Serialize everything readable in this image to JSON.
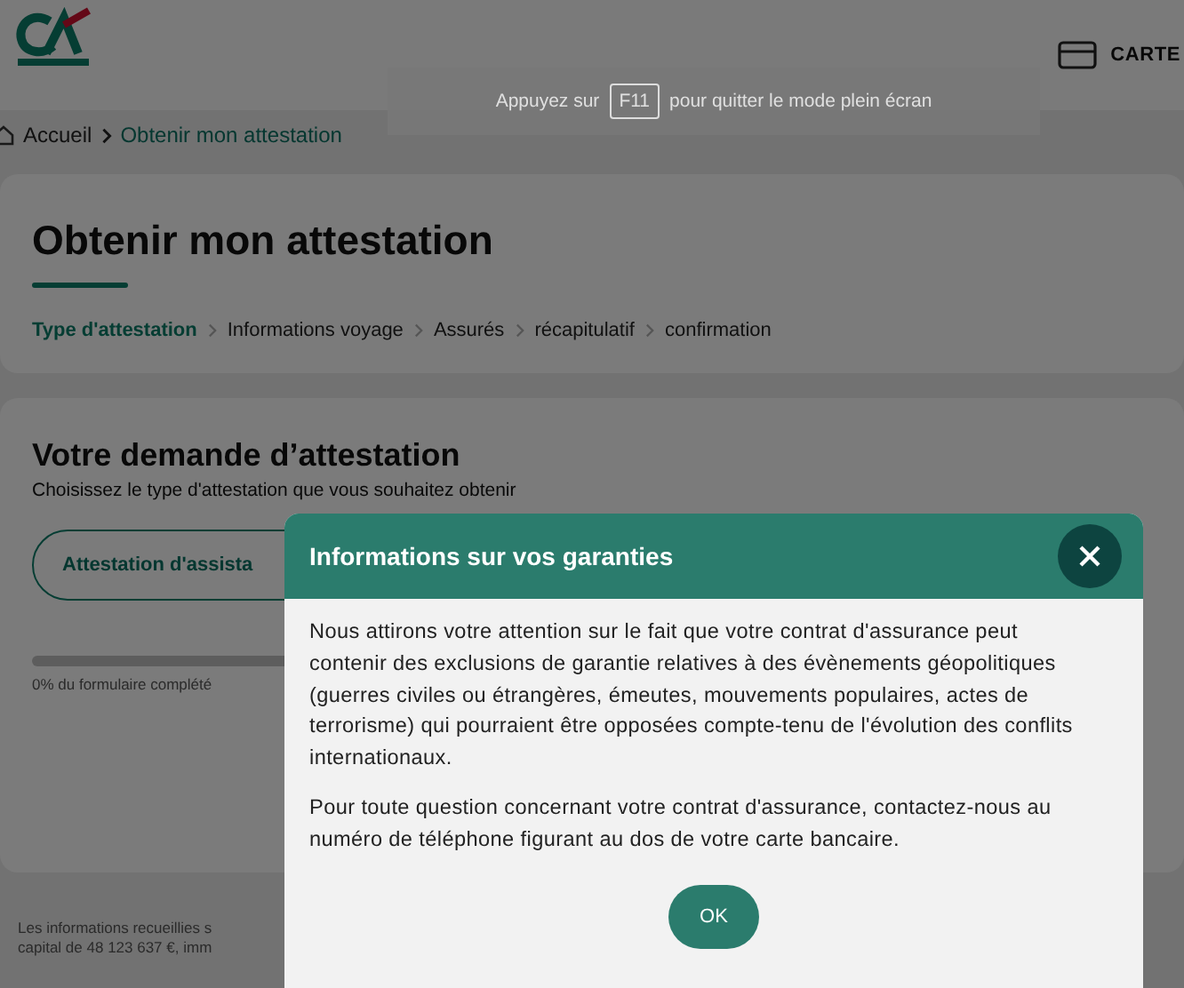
{
  "header": {
    "card_label": "CARTE"
  },
  "fullscreen_notice": {
    "before": "Appuyez sur",
    "key": "F11",
    "after": "pour quitter le mode plein écran"
  },
  "breadcrumb": [
    {
      "label": "Accueil",
      "current": false
    },
    {
      "label": "Obtenir mon attestation",
      "current": true
    }
  ],
  "page_title": "Obtenir mon attestation",
  "steps": [
    {
      "label": "Type d'attestation",
      "selected": true
    },
    {
      "label": "Informations voyage",
      "selected": false
    },
    {
      "label": "Assurés",
      "selected": false
    },
    {
      "label": "récapitulatif",
      "selected": false
    },
    {
      "label": "confirmation",
      "selected": false
    }
  ],
  "request": {
    "title": "Votre demande d’attestation",
    "subtitle": "Choisissez le type d'attestation que vous souhaitez obtenir",
    "option": "Attestation d'assista",
    "progress": {
      "level": 0
    },
    "progress_text": "0% du formulaire complété"
  },
  "footer": [
    "Les informations recueillies s",
    "capital de 48 123 637 €, imm"
  ],
  "modal": {
    "title": "Informations sur vos garanties",
    "paragraphs": [
      "Nous attirons votre attention sur le fait que votre contrat d'assurance peut contenir des exclusions de garantie relatives à des évènements géopolitiques (guerres civiles ou étrangères, émeutes, mouvements populaires, actes de terrorisme) qui pourraient être opposées compte-tenu de l'évolution des conflits internationaux.",
      "Pour toute question concernant votre contrat d'assurance, contactez-nous au numéro de téléphone figurant au dos de votre carte bancaire."
    ],
    "button": "OK"
  }
}
